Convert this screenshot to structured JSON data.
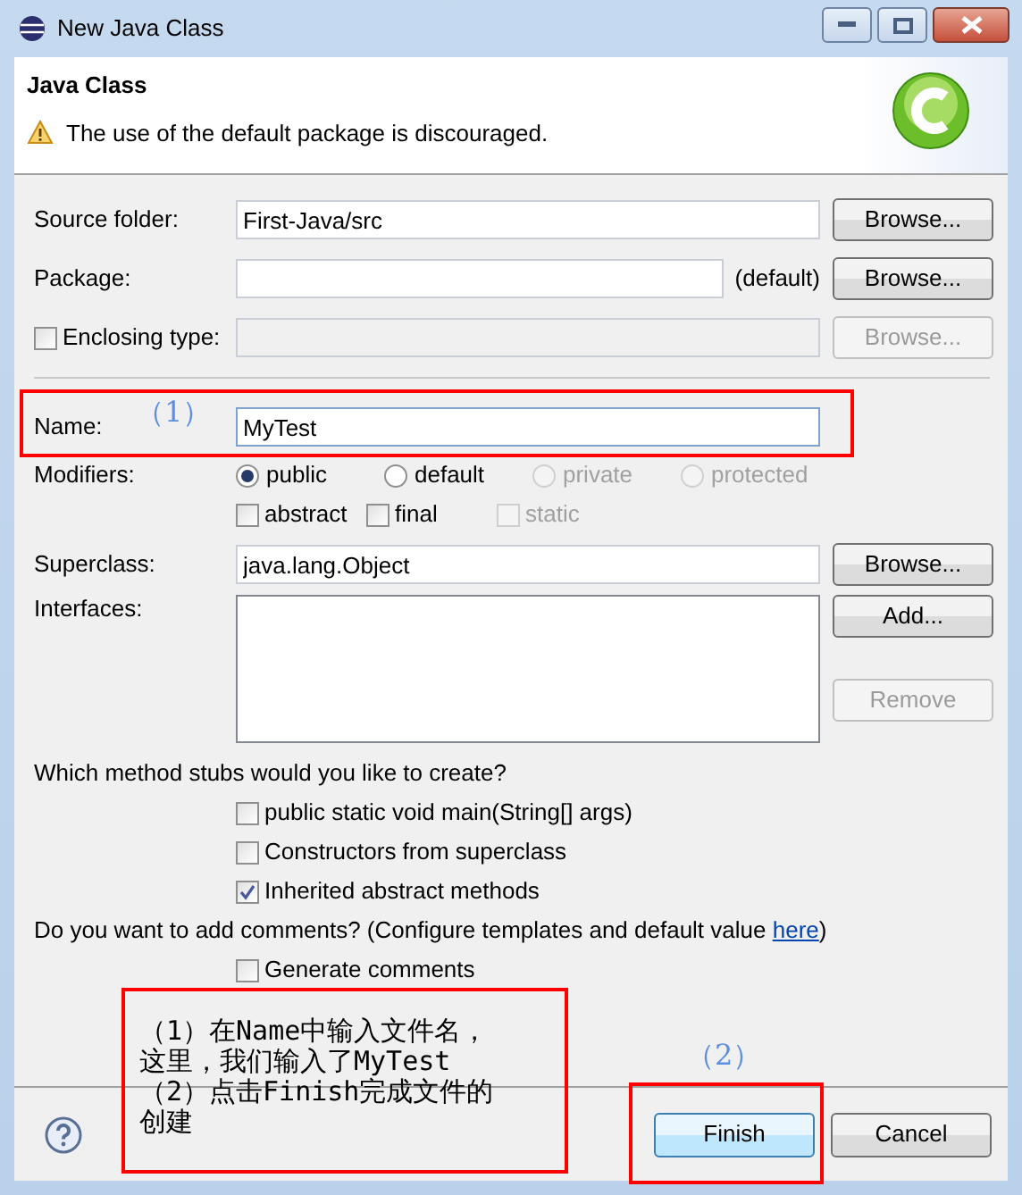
{
  "window": {
    "title": "New Java Class"
  },
  "header": {
    "title": "Java Class",
    "message": "The use of the default package is discouraged."
  },
  "top_fields": [
    {
      "label": "Source folder:",
      "value": "First-Java/src",
      "button": {
        "label": "Browse...",
        "disabled": false
      }
    },
    {
      "label": "Package:",
      "suffix": "(default)",
      "button": {
        "label": "Browse...",
        "disabled": false
      }
    },
    {
      "label": "Enclosing type:",
      "checked": false,
      "field_disabled": true,
      "button": {
        "label": "Browse...",
        "disabled": true
      }
    }
  ],
  "name_field": {
    "label": "Name:",
    "value": "MyTest"
  },
  "modifiers": {
    "label": "Modifiers:",
    "radios": [
      {
        "label": "public",
        "selected": true,
        "disabled": false
      },
      {
        "label": "default",
        "selected": false,
        "disabled": false
      },
      {
        "label": "private",
        "selected": false,
        "disabled": true
      },
      {
        "label": "protected",
        "selected": false,
        "disabled": true
      }
    ],
    "checkboxes": [
      {
        "label": "abstract",
        "checked": false,
        "disabled": false
      },
      {
        "label": "final",
        "checked": false,
        "disabled": false
      },
      {
        "label": "static",
        "checked": false,
        "disabled": true
      }
    ]
  },
  "superclass": {
    "label": "Superclass:",
    "value": "java.lang.Object",
    "button": {
      "label": "Browse...",
      "disabled": false
    }
  },
  "interfaces": {
    "label": "Interfaces:",
    "buttons": [
      {
        "label": "Add...",
        "disabled": false
      },
      {
        "label": "Remove",
        "disabled": true
      }
    ]
  },
  "stubs": {
    "question": "Which method stubs would you like to create?",
    "options": [
      {
        "label": "public static void main(String[] args)",
        "checked": false
      },
      {
        "label": "Constructors from superclass",
        "checked": false
      },
      {
        "label": "Inherited abstract methods",
        "checked": true
      }
    ]
  },
  "comments": {
    "question": "Do you want to add comments? (Configure templates and default value ",
    "link": "here",
    "question_end": ")",
    "options": [
      {
        "label": "Generate comments",
        "checked": false
      }
    ]
  },
  "footer": {
    "buttons": [
      {
        "label": "Finish",
        "default": true
      },
      {
        "label": "Cancel",
        "default": false
      }
    ]
  },
  "annotations": {
    "marker_name": "（1）",
    "marker_finish": "（2）",
    "note_lines": [
      "（1）在Name中输入文件名，",
      "这里，我们输入了MyTest",
      "（2）点击Finish完成文件的",
      "创建"
    ]
  }
}
